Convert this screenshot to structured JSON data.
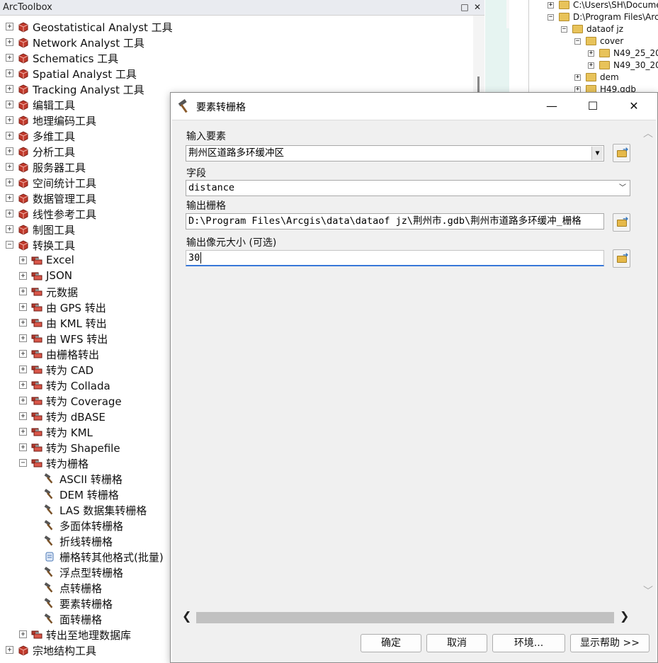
{
  "toolbox": {
    "title": "ArcToolbox",
    "items": [
      {
        "label": "Geostatistical Analyst 工具",
        "level": 0,
        "expander": "+",
        "icon": "toolbox-icon"
      },
      {
        "label": "Network Analyst 工具",
        "level": 0,
        "expander": "+",
        "icon": "toolbox-icon"
      },
      {
        "label": "Schematics 工具",
        "level": 0,
        "expander": "+",
        "icon": "toolbox-icon"
      },
      {
        "label": "Spatial Analyst 工具",
        "level": 0,
        "expander": "+",
        "icon": "toolbox-icon"
      },
      {
        "label": "Tracking Analyst 工具",
        "level": 0,
        "expander": "+",
        "icon": "toolbox-icon"
      },
      {
        "label": "编辑工具",
        "level": 0,
        "expander": "+",
        "icon": "toolbox-icon"
      },
      {
        "label": "地理编码工具",
        "level": 0,
        "expander": "+",
        "icon": "toolbox-icon"
      },
      {
        "label": "多维工具",
        "level": 0,
        "expander": "+",
        "icon": "toolbox-icon"
      },
      {
        "label": "分析工具",
        "level": 0,
        "expander": "+",
        "icon": "toolbox-icon"
      },
      {
        "label": "服务器工具",
        "level": 0,
        "expander": "+",
        "icon": "toolbox-icon"
      },
      {
        "label": "空间统计工具",
        "level": 0,
        "expander": "+",
        "icon": "toolbox-icon"
      },
      {
        "label": "数据管理工具",
        "level": 0,
        "expander": "+",
        "icon": "toolbox-icon"
      },
      {
        "label": "线性参考工具",
        "level": 0,
        "expander": "+",
        "icon": "toolbox-icon"
      },
      {
        "label": "制图工具",
        "level": 0,
        "expander": "+",
        "icon": "toolbox-icon"
      },
      {
        "label": "转换工具",
        "level": 0,
        "expander": "−",
        "icon": "toolbox-icon"
      },
      {
        "label": "Excel",
        "level": 1,
        "expander": "+",
        "icon": "toolset-icon"
      },
      {
        "label": "JSON",
        "level": 1,
        "expander": "+",
        "icon": "toolset-icon"
      },
      {
        "label": "元数据",
        "level": 1,
        "expander": "+",
        "icon": "toolset-icon"
      },
      {
        "label": "由 GPS 转出",
        "level": 1,
        "expander": "+",
        "icon": "toolset-icon"
      },
      {
        "label": "由 KML 转出",
        "level": 1,
        "expander": "+",
        "icon": "toolset-icon"
      },
      {
        "label": "由 WFS 转出",
        "level": 1,
        "expander": "+",
        "icon": "toolset-icon"
      },
      {
        "label": "由栅格转出",
        "level": 1,
        "expander": "+",
        "icon": "toolset-icon"
      },
      {
        "label": "转为 CAD",
        "level": 1,
        "expander": "+",
        "icon": "toolset-icon"
      },
      {
        "label": "转为 Collada",
        "level": 1,
        "expander": "+",
        "icon": "toolset-icon"
      },
      {
        "label": "转为 Coverage",
        "level": 1,
        "expander": "+",
        "icon": "toolset-icon"
      },
      {
        "label": "转为 dBASE",
        "level": 1,
        "expander": "+",
        "icon": "toolset-icon"
      },
      {
        "label": "转为 KML",
        "level": 1,
        "expander": "+",
        "icon": "toolset-icon"
      },
      {
        "label": "转为 Shapefile",
        "level": 1,
        "expander": "+",
        "icon": "toolset-icon"
      },
      {
        "label": "转为栅格",
        "level": 1,
        "expander": "−",
        "icon": "toolset-icon"
      },
      {
        "label": "ASCII 转栅格",
        "level": 2,
        "expander": "",
        "icon": "hammer-icon"
      },
      {
        "label": "DEM 转栅格",
        "level": 2,
        "expander": "",
        "icon": "hammer-icon"
      },
      {
        "label": "LAS 数据集转栅格",
        "level": 2,
        "expander": "",
        "icon": "hammer-icon"
      },
      {
        "label": "多面体转栅格",
        "level": 2,
        "expander": "",
        "icon": "hammer-icon"
      },
      {
        "label": "折线转栅格",
        "level": 2,
        "expander": "",
        "icon": "hammer-icon"
      },
      {
        "label": "栅格转其他格式(批量)",
        "level": 2,
        "expander": "",
        "icon": "script-icon"
      },
      {
        "label": "浮点型转栅格",
        "level": 2,
        "expander": "",
        "icon": "hammer-icon"
      },
      {
        "label": "点转栅格",
        "level": 2,
        "expander": "",
        "icon": "hammer-icon"
      },
      {
        "label": "要素转栅格",
        "level": 2,
        "expander": "",
        "icon": "hammer-icon"
      },
      {
        "label": "面转栅格",
        "level": 2,
        "expander": "",
        "icon": "hammer-icon"
      },
      {
        "label": "转出至地理数据库",
        "level": 1,
        "expander": "+",
        "icon": "toolset-icon"
      },
      {
        "label": "宗地结构工具",
        "level": 0,
        "expander": "+",
        "icon": "toolbox-icon"
      }
    ]
  },
  "catalog": {
    "items": [
      {
        "label": "C:\\Users\\SH\\Docume",
        "level": 0,
        "expander": "+"
      },
      {
        "label": "D:\\Program Files\\Arc",
        "level": 0,
        "expander": "−"
      },
      {
        "label": "dataof jz",
        "level": 1,
        "expander": "−"
      },
      {
        "label": "cover",
        "level": 2,
        "expander": "−"
      },
      {
        "label": "N49_25_20",
        "level": 3,
        "expander": "+"
      },
      {
        "label": "N49_30_20",
        "level": 3,
        "expander": "+"
      },
      {
        "label": "dem",
        "level": 2,
        "expander": "+"
      },
      {
        "label": "H49.gdb",
        "level": 2,
        "expander": "+"
      }
    ]
  },
  "dialog": {
    "title": "要素转栅格",
    "input_features": {
      "label": "输入要素",
      "value": "荆州区道路多环缓冲区"
    },
    "field": {
      "label": "字段",
      "value": "distance"
    },
    "output_raster": {
      "label": "输出栅格",
      "value": "D:\\Program Files\\Arcgis\\data\\dataof jz\\荆州市.gdb\\荆州市道路多环缓冲_栅格"
    },
    "cell_size": {
      "label": "输出像元大小 (可选)",
      "value": "30"
    },
    "buttons": {
      "ok": "确定",
      "cancel": "取消",
      "environments": "环境...",
      "show_help": "显示帮助 >>"
    }
  },
  "colors": {
    "toolbox_icon": "#c0392b",
    "folder": "#e8c35a",
    "focus_underline": "#3878d8"
  }
}
